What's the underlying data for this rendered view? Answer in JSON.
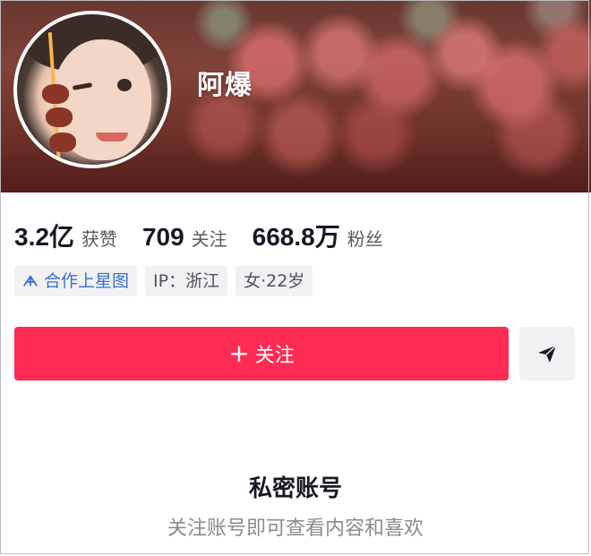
{
  "profile": {
    "username": "阿爆"
  },
  "stats": [
    {
      "value": "3.2亿",
      "label": "获赞"
    },
    {
      "value": "709",
      "label": "关注"
    },
    {
      "value": "668.8万",
      "label": "粉丝"
    }
  ],
  "tags": {
    "star": "合作上星图",
    "ip": "IP：浙江",
    "gender_age": "女·22岁"
  },
  "actions": {
    "follow_plus": "+",
    "follow_label": "关注"
  },
  "private": {
    "title": "私密账号",
    "subtitle": "关注账号即可查看内容和喜欢"
  },
  "colors": {
    "accent": "#fe2c55",
    "star_link": "#3a6fd1",
    "tag_bg": "#f2f2f4"
  },
  "icons": {
    "star_tag": "star-map-icon",
    "share": "send-icon"
  }
}
